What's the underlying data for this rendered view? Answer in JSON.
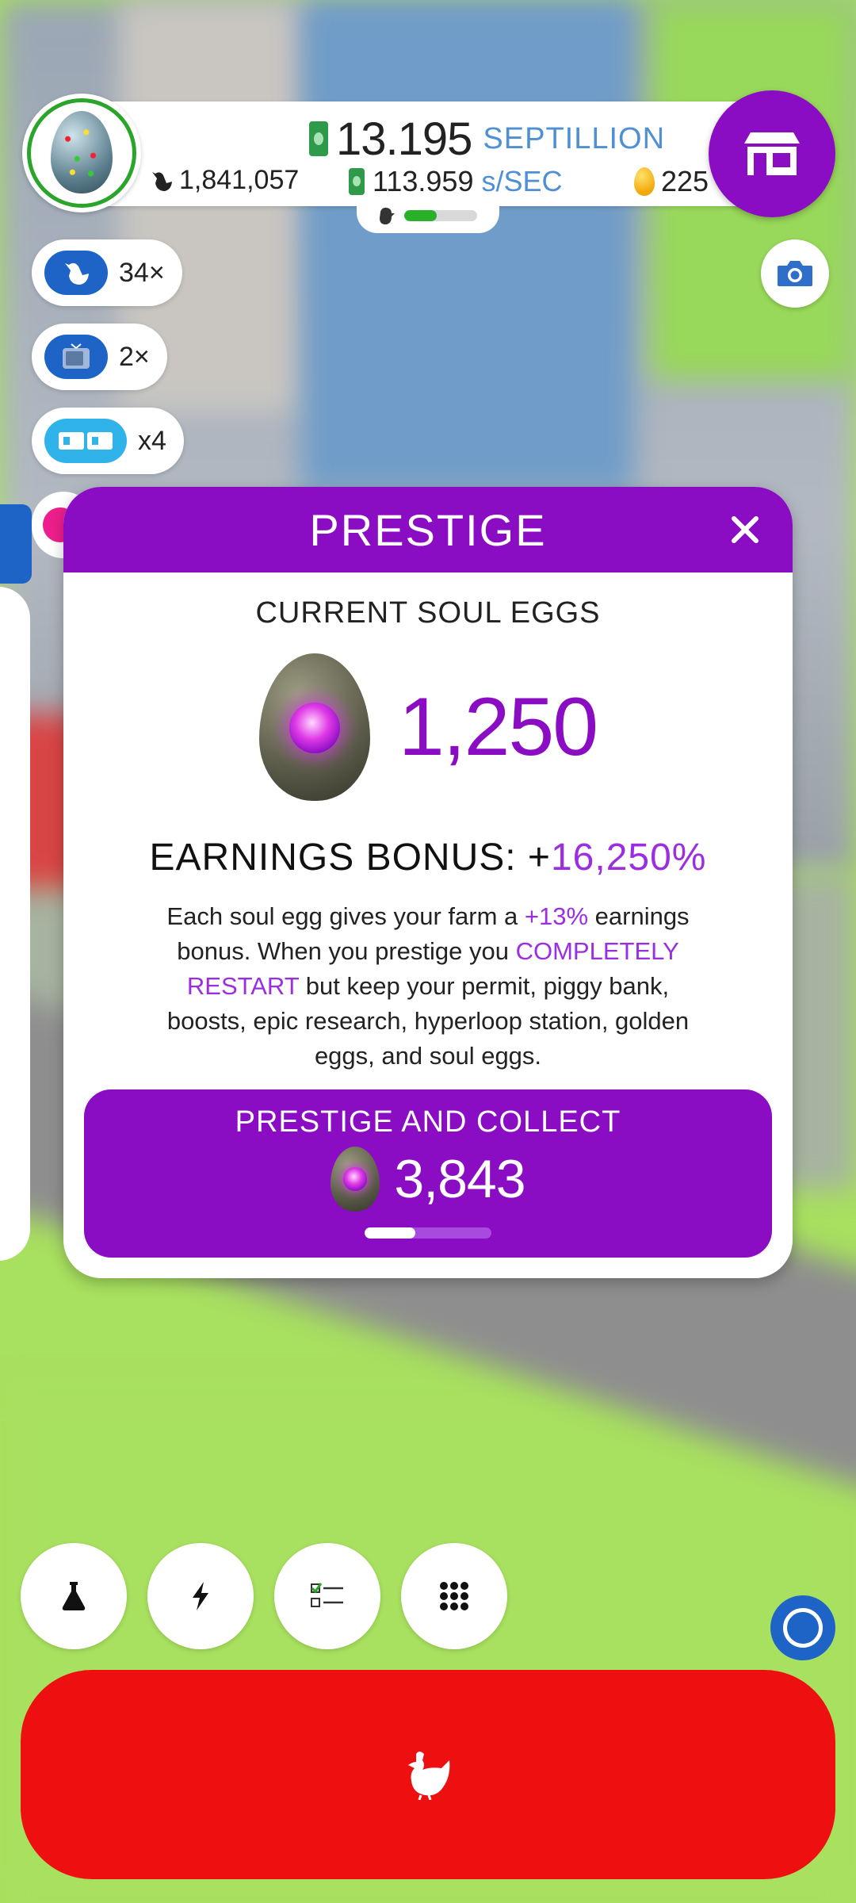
{
  "top_bar": {
    "money_value": "13.195",
    "money_unit": "SEPTILLION",
    "chickens": "1,841,057",
    "earnings_rate": "113.959",
    "earnings_unit": "s/SEC",
    "golden_eggs": "225",
    "population_progress": 0.45
  },
  "boosts": [
    {
      "icon": "chicken-icon",
      "multiplier": "34×"
    },
    {
      "icon": "tv-icon",
      "multiplier": "2×"
    },
    {
      "icon": "video-doubler-icon",
      "multiplier": "x4"
    }
  ],
  "prestige_dialog": {
    "title": "PRESTIGE",
    "subtitle": "CURRENT SOUL EGGS",
    "soul_eggs": "1,250",
    "bonus_label": "EARNINGS BONUS: +",
    "bonus_value": "16,250%",
    "desc_1": "Each soul egg gives your farm a ",
    "desc_highlight_1": "+13%",
    "desc_2": " earnings bonus. When you prestige you ",
    "desc_highlight_2": "COMPLETELY RESTART",
    "desc_3": " but keep your permit, piggy bank, boosts, epic research, hyperloop station, golden eggs, and soul eggs.",
    "collect_label": "PRESTIGE AND COLLECT",
    "collect_amount": "3,843",
    "collect_progress": 0.4
  },
  "colors": {
    "purple": "#8a0dc4",
    "highlight": "#9a2ee0",
    "accent_blue": "#4f8fd3",
    "red": "#ee1010",
    "grass": "#a8e05f"
  }
}
